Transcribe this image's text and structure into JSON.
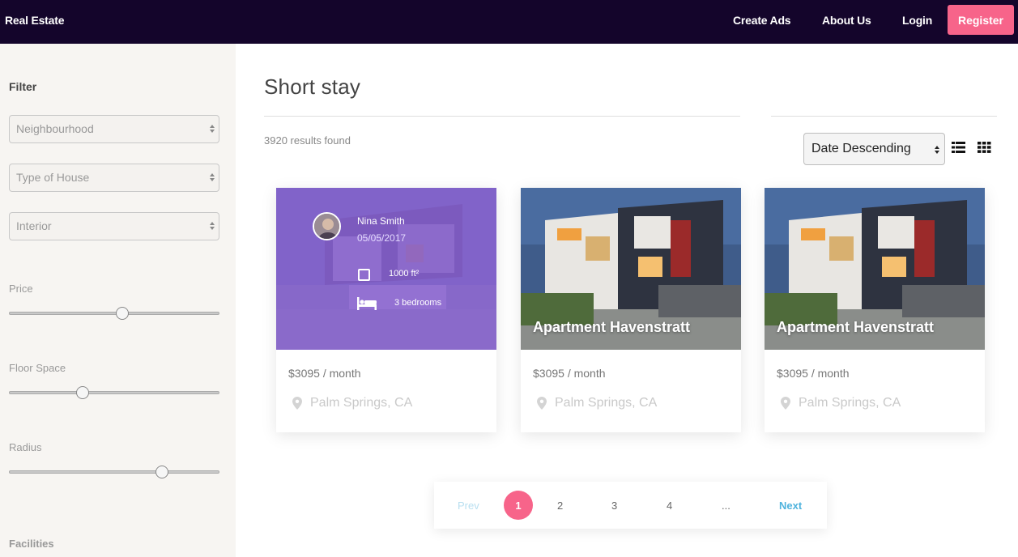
{
  "nav": {
    "brand": "Real Estate",
    "links": [
      "Create Ads",
      "About Us",
      "Login"
    ],
    "register": "Register"
  },
  "sidebar": {
    "title": "Filter",
    "selects": [
      "Neighbourhood",
      "Type of House",
      "Interior"
    ],
    "sliders": [
      {
        "label": "Price",
        "value": 0.54
      },
      {
        "label": "Floor Space",
        "value": 0.35
      },
      {
        "label": "Radius",
        "value": 0.73
      }
    ],
    "facilities": "Facilities"
  },
  "main": {
    "title": "Short stay",
    "results": "3920 results found",
    "sort": "Date Descending",
    "view_icons": [
      "list-view-icon",
      "grid-view-icon"
    ]
  },
  "cards": [
    {
      "overlay": true,
      "agent_name": "Nina Smith",
      "date": "05/05/2017",
      "area": "1000 ft²",
      "bedrooms": "3 bedrooms",
      "price": "$3095 / month",
      "location": "Palm Springs, CA"
    },
    {
      "caption": "Apartment Havenstratt",
      "price": "$3095 / month",
      "location": "Palm Springs, CA"
    },
    {
      "caption": "Apartment Havenstratt",
      "price": "$3095 / month",
      "location": "Palm Springs, CA"
    }
  ],
  "pagination": {
    "prev": "Prev",
    "pages": [
      "1",
      "2",
      "3",
      "4",
      "..."
    ],
    "next": "Next",
    "active": "1"
  },
  "colors": {
    "nav_bg": "#14052b",
    "accent": "#f7648a",
    "overlay": "#825ad2",
    "link_blue": "#4fb3dd"
  }
}
